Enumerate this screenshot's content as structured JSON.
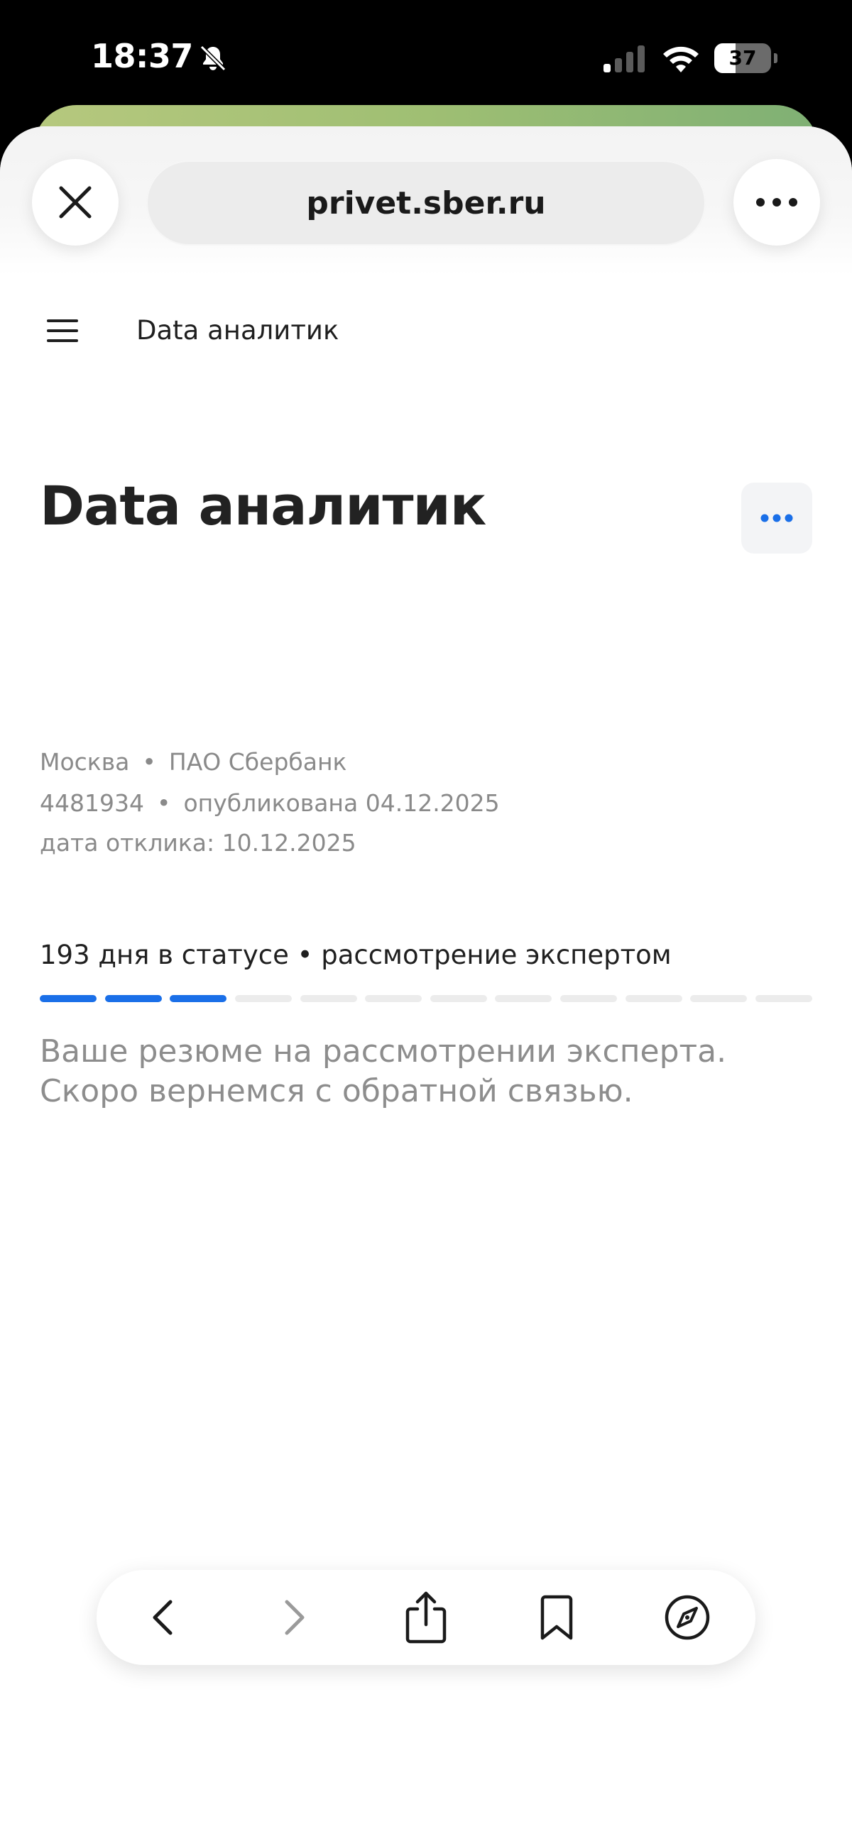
{
  "status_bar": {
    "time": "18:37",
    "battery_level": "37",
    "battery_fraction": 0.37,
    "icons": [
      "bell-slash-icon",
      "cellular-signal-icon",
      "wifi-icon",
      "battery-icon"
    ]
  },
  "browser": {
    "url": "privet.sber.ru",
    "icons": [
      "close-icon",
      "more-horizontal-icon"
    ]
  },
  "site_header": {
    "title": "Data аналитик",
    "icons": [
      "hamburger-menu-icon"
    ]
  },
  "vacancy": {
    "title": "Data аналитик",
    "city": "Москва",
    "company": "ПАО Сбербанк",
    "id": "4481934",
    "published": "опубликована 04.12.2025",
    "response_date": "дата отклика: 10.12.2025",
    "separator": "•",
    "options_icon": "more-dots-icon"
  },
  "status": {
    "text": "193 дня в статусе • рассмотрение экспертом",
    "progress_total_segments": 12,
    "progress_active_segments": 3,
    "description": "Ваше резюме на рассмотрении эксперта. Скоро вернемся с обратной связью."
  },
  "toolbar": {
    "icons": [
      "back-icon",
      "forward-icon",
      "share-icon",
      "bookmarks-icon",
      "compass-icon"
    ]
  },
  "colors": {
    "accent": "#1a6fe8",
    "inactive_segment": "#ececec",
    "muted_text": "#8a8a8a"
  }
}
